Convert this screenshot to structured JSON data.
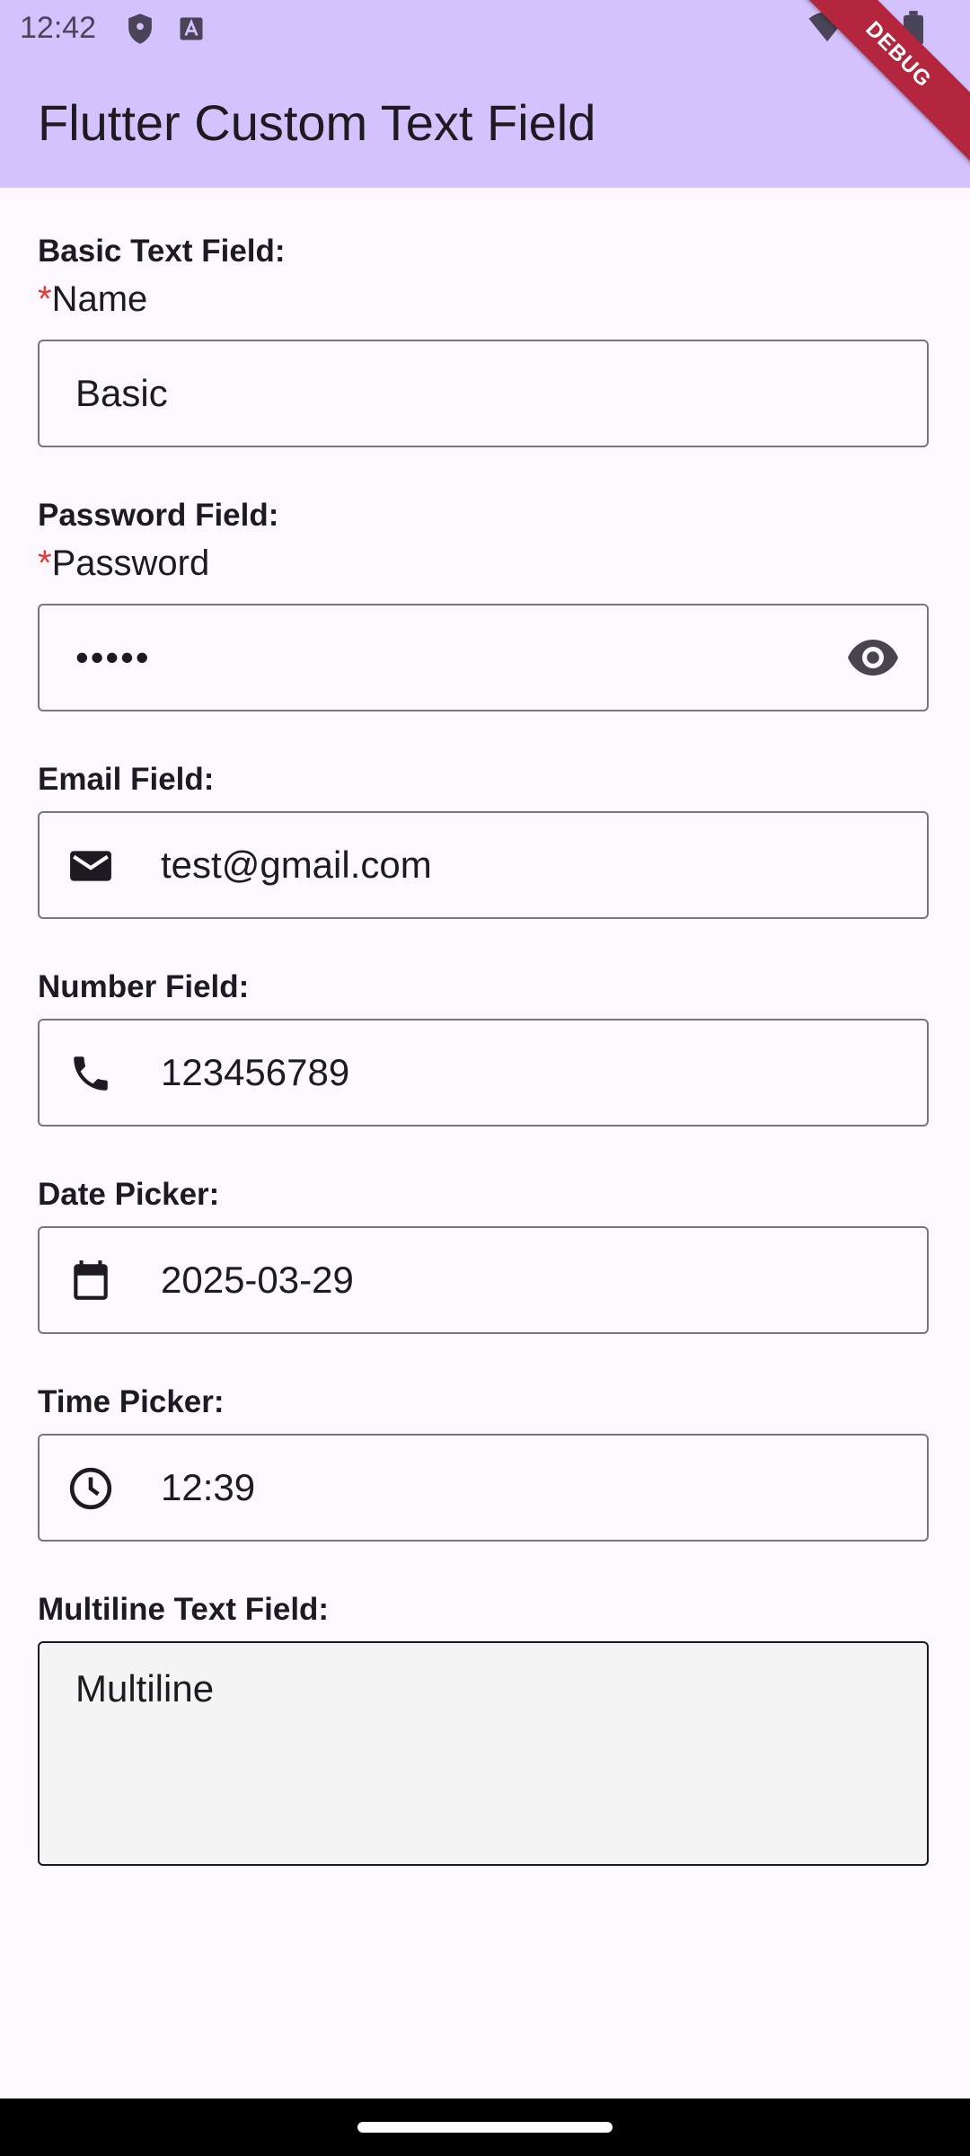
{
  "status_bar": {
    "time": "12:42"
  },
  "app_bar": {
    "title": "Flutter Custom Text Field",
    "debug_banner": "DEBUG"
  },
  "form": {
    "basic": {
      "section_label": "Basic Text Field:",
      "required_mark": "*",
      "label": "Name",
      "value": "Basic"
    },
    "password": {
      "section_label": "Password Field:",
      "required_mark": "*",
      "label": "Password",
      "value": "•••••",
      "trailing_icon": "visibility-icon"
    },
    "email": {
      "section_label": "Email Field:",
      "value": "test@gmail.com",
      "leading_icon": "mail-icon"
    },
    "number": {
      "section_label": "Number Field:",
      "value": "123456789",
      "leading_icon": "phone-icon"
    },
    "date": {
      "section_label": "Date Picker:",
      "value": "2025-03-29",
      "leading_icon": "calendar-icon"
    },
    "time": {
      "section_label": "Time Picker:",
      "value": "12:39",
      "leading_icon": "clock-icon"
    },
    "multiline": {
      "section_label": "Multiline Text Field:",
      "value": "Multiline"
    }
  },
  "colors": {
    "app_bar": "#d3c2fd",
    "background": "#fdf7ff",
    "required": "#e53935",
    "debug": "#b3263e"
  }
}
